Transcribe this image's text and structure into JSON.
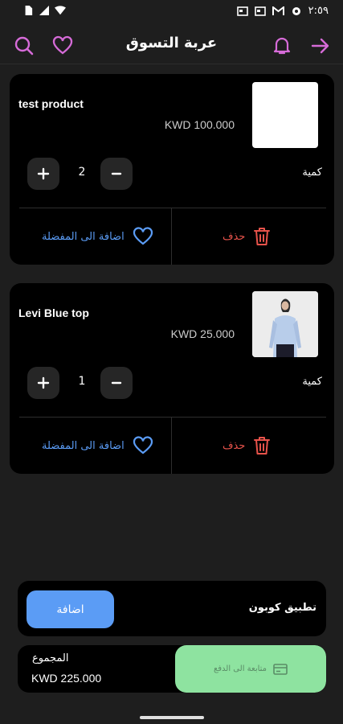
{
  "status_bar": {
    "time": "٢:٥٩",
    "icons": [
      "sim-icon",
      "wifi-icon",
      "signal-icon",
      "news-icon",
      "news-icon",
      "gmail-icon",
      "settings-icon"
    ]
  },
  "app_bar": {
    "title": "عربة التسوق",
    "icons": [
      "search-icon",
      "heart-icon",
      "bell-icon",
      "arrow-right-icon"
    ],
    "accent": "#d66bd8"
  },
  "cart_items": [
    {
      "name": "test product",
      "price": "KWD 100.000",
      "quantity": "2",
      "qty_label": "كمية",
      "favorite_label": "اضافة الى المفضلة",
      "delete_label": "حذف",
      "image": "blank-white"
    },
    {
      "name": "Levi Blue top",
      "price": "KWD 25.000",
      "quantity": "1",
      "qty_label": "كمية",
      "favorite_label": "اضافة الى المفضلة",
      "delete_label": "حذف",
      "image": "model-blue-top-photo"
    }
  ],
  "coupon": {
    "label": "تطبيق كوبون",
    "button": "اضافة"
  },
  "total": {
    "label": "المجموع",
    "value": "KWD 225.000",
    "checkout_label": "متابعة الى الدفع"
  },
  "colors": {
    "favorite": "#5b9cf5",
    "delete": "#e8534b",
    "checkout": "#8ee3a0"
  }
}
